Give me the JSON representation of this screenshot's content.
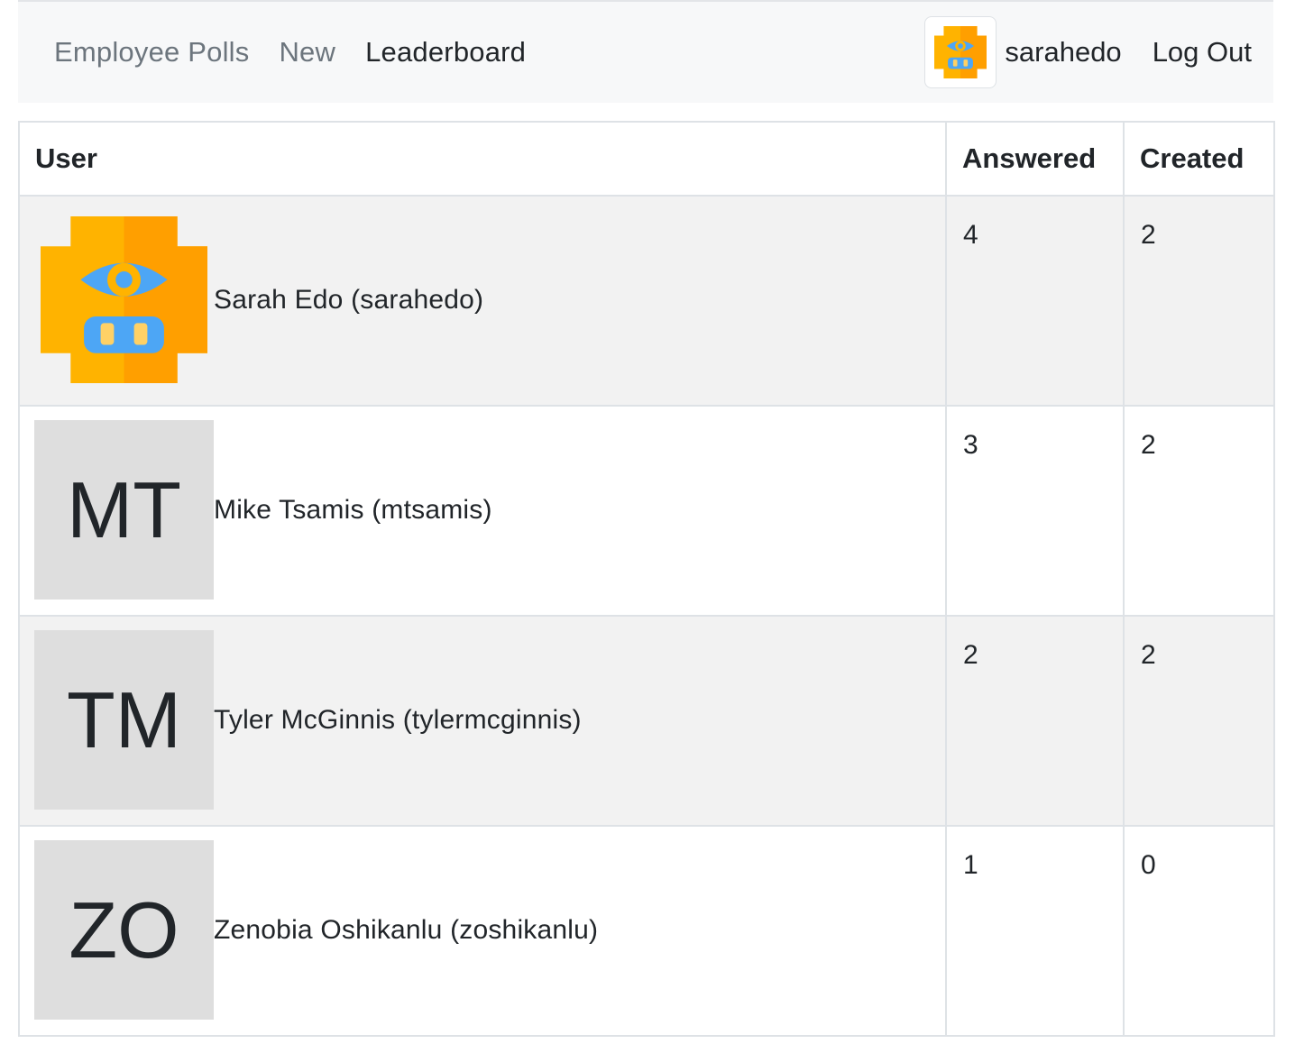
{
  "nav": {
    "brand": "Employee Polls",
    "links": [
      "New",
      "Leaderboard"
    ],
    "username": "sarahedo",
    "logout_label": "Log Out"
  },
  "table": {
    "headers": [
      "User",
      "Answered",
      "Created"
    ],
    "rows": [
      {
        "avatar": "robot-avatar",
        "name": "Sarah Edo (sarahedo)",
        "answered": "4",
        "created": "2"
      },
      {
        "initials": "MT",
        "name": "Mike Tsamis (mtsamis)",
        "answered": "3",
        "created": "2"
      },
      {
        "initials": "TM",
        "name": "Tyler McGinnis (tylermcginnis)",
        "answered": "2",
        "created": "2"
      },
      {
        "initials": "ZO",
        "name": "Zenobia Oshikanlu (zoshikanlu)",
        "answered": "1",
        "created": "0"
      }
    ]
  },
  "colors": {
    "navbar_bg": "#f7f8f9",
    "stripe": "#f2f2f2",
    "avatar_orange": "#ffb300",
    "avatar_blue": "#4da6f5"
  }
}
